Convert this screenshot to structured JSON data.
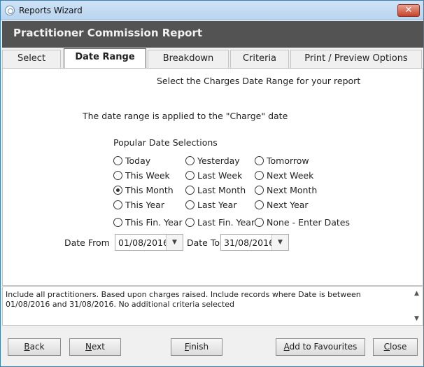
{
  "window": {
    "title": "Reports Wizard",
    "close_glyph": "✕"
  },
  "header": {
    "title": "Practitioner Commission Report"
  },
  "tabs": [
    {
      "label": "Select"
    },
    {
      "label": "Date Range",
      "active": true
    },
    {
      "label": "Breakdown"
    },
    {
      "label": "Criteria"
    },
    {
      "label": "Print / Preview Options"
    }
  ],
  "date_range": {
    "subtitle": "Select the Charges Date Range for your report",
    "note": "The date range is applied to the \"Charge\" date",
    "popular_label": "Popular Date Selections",
    "options": [
      {
        "label": "Today",
        "checked": false
      },
      {
        "label": "Yesterday",
        "checked": false
      },
      {
        "label": "Tomorrow",
        "checked": false
      },
      {
        "label": "This Week",
        "checked": false
      },
      {
        "label": "Last Week",
        "checked": false
      },
      {
        "label": "Next Week",
        "checked": false
      },
      {
        "label": "This Month",
        "checked": true
      },
      {
        "label": "Last Month",
        "checked": false
      },
      {
        "label": "Next Month",
        "checked": false
      },
      {
        "label": "This Year",
        "checked": false
      },
      {
        "label": "Last Year",
        "checked": false
      },
      {
        "label": "Next Year",
        "checked": false
      },
      {
        "label": "This Fin. Year",
        "checked": false
      },
      {
        "label": "Last Fin. Year",
        "checked": false
      },
      {
        "label": "None - Enter Dates",
        "checked": false
      }
    ],
    "date_from_label": "Date From",
    "date_from_value": "01/08/2016",
    "date_to_label": "Date To",
    "date_to_value": "31/08/2016",
    "dropdown_glyph": "▼"
  },
  "summary": {
    "text": "Include all practitioners. Based upon charges raised. Include records where Date is between 01/08/2016 and 31/08/2016. No additional criteria selected",
    "scroll_up_glyph": "▲",
    "scroll_down_glyph": "▼"
  },
  "footer": {
    "back": {
      "first": "B",
      "rest": "ack"
    },
    "next": {
      "first": "N",
      "rest": "ext"
    },
    "finish": {
      "first": "F",
      "rest": "inish"
    },
    "favourites": {
      "first": "A",
      "rest": "dd to Favourites"
    },
    "close": {
      "first": "C",
      "rest": "lose"
    }
  }
}
